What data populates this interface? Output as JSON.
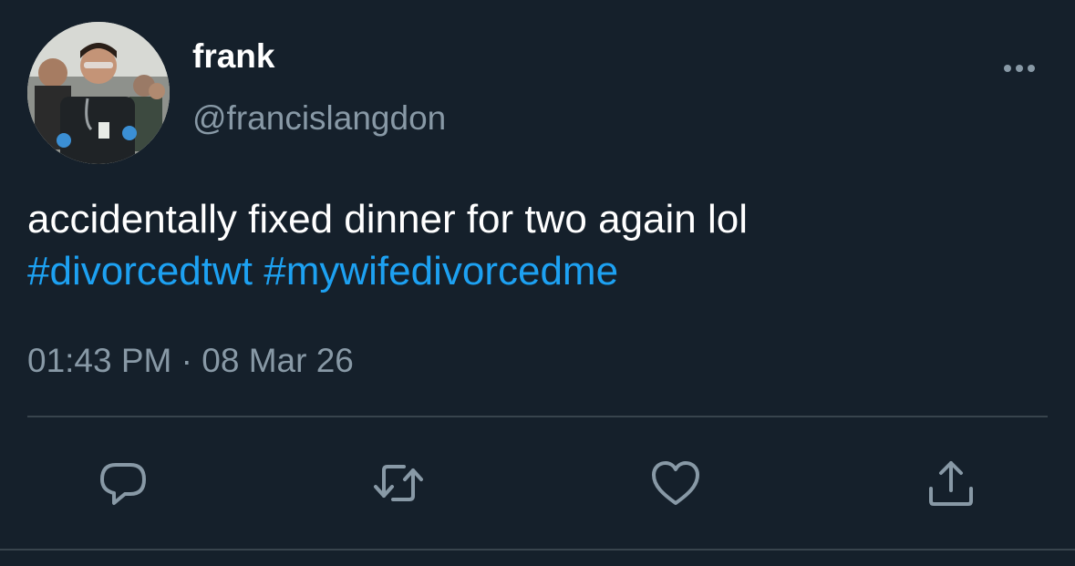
{
  "tweet": {
    "display_name": "frank",
    "handle": "@francislangdon",
    "text_plain": "accidentally fixed dinner for two again lol",
    "hashtags": [
      "#divorcedtwt",
      "#mywifedivorcedme"
    ],
    "time": "01:43 PM",
    "separator": "·",
    "date": "08 Mar 26"
  },
  "icons": {
    "more": "more-horizontal-icon",
    "reply": "reply-icon",
    "retweet": "retweet-icon",
    "like": "heart-icon",
    "share": "share-icon"
  },
  "colors": {
    "background": "#15202b",
    "text": "#ffffff",
    "secondary": "#8899a6",
    "link": "#1da1f2",
    "divider": "#38444d"
  }
}
